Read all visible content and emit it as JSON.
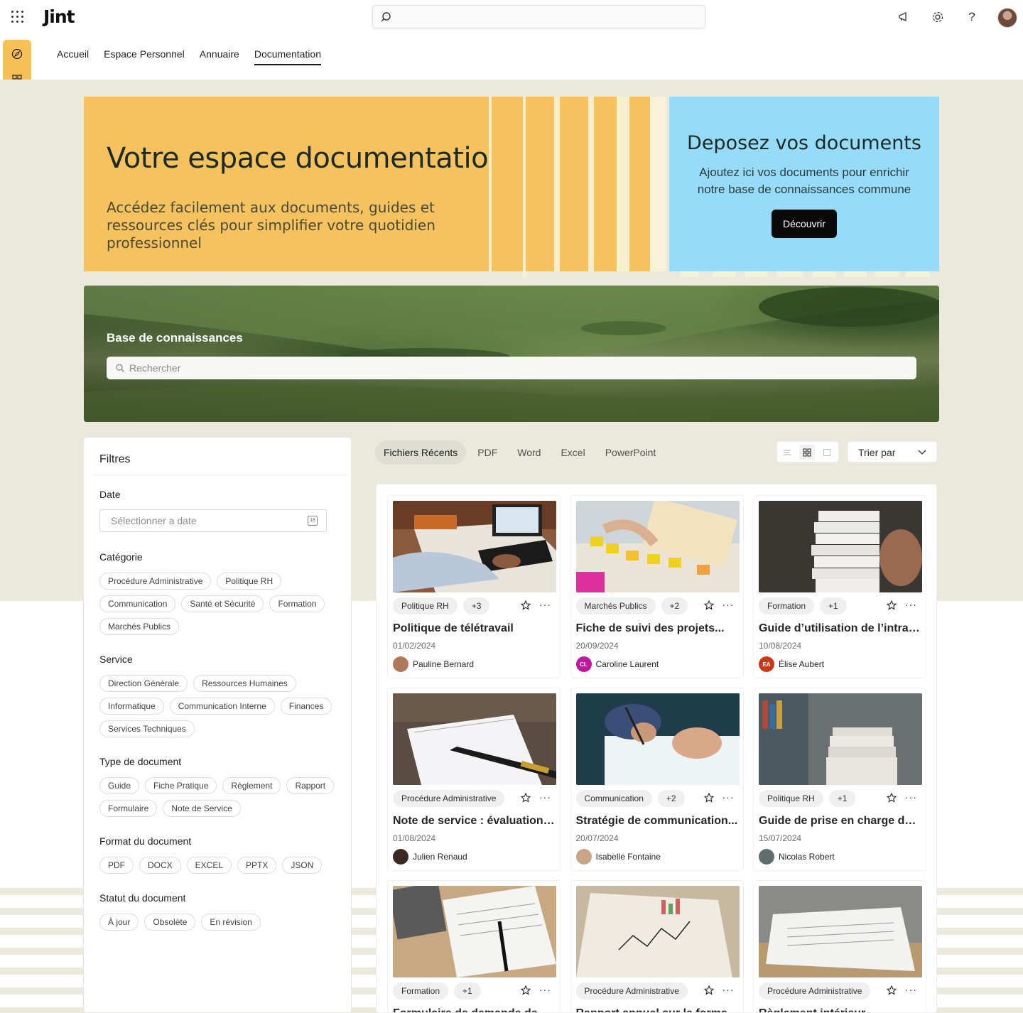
{
  "app": {
    "logo": "Jint"
  },
  "nav": {
    "items": [
      "Accueil",
      "Espace Personnel",
      "Annuaire",
      "Documentation"
    ],
    "active": "Documentation"
  },
  "hero": {
    "title": "Votre espace documentation",
    "subtitle": "Accédez facilement aux documents, guides et ressources clés pour simplifier votre quotidien professionnel"
  },
  "deposit": {
    "title": "Deposez vos documents",
    "text": "Ajoutez ici vos documents pour enrichir notre base de connaissances commune",
    "button": "Découvrir"
  },
  "knowledge": {
    "title": "Base de connaissances",
    "placeholder": "Rechercher"
  },
  "filters": {
    "title": "Filtres",
    "date_label": "Date",
    "date_placeholder": "Sélectionner a date",
    "sections": [
      {
        "title": "Catégorie",
        "chips": [
          "Procédure Administrative",
          "Politique RH",
          "Communication",
          "Santé et Sécurité",
          "Formation",
          "Marchés Publics"
        ]
      },
      {
        "title": "Service",
        "chips": [
          "Direction Générale",
          "Ressources Humaines",
          "Informatique",
          "Communication Interne",
          "Finances",
          "Services Techniques"
        ]
      },
      {
        "title": "Type de document",
        "chips": [
          "Guide",
          "Fiche Pratique",
          "Règlement",
          "Rapport",
          "Formulaire",
          "Note de Service"
        ]
      },
      {
        "title": "Format du document",
        "chips": [
          "PDF",
          "DOCX",
          "EXCEL",
          "PPTX",
          "JSON"
        ]
      },
      {
        "title": "Statut du document",
        "chips": [
          "À jour",
          "Obsolète",
          "En révision"
        ]
      }
    ]
  },
  "tabs": {
    "items": [
      "Fichiers Récents",
      "PDF",
      "Word",
      "Excel",
      "PowerPoint"
    ],
    "active": "Fichiers Récents"
  },
  "sort": {
    "label": "Trier par"
  },
  "cards": [
    {
      "tag": "Politique RH",
      "extra": "+3",
      "title": "Politique de télétravail",
      "date": "01/02/2024",
      "author": "Pauline Bernard",
      "initials": "",
      "avatar_color": "#b07a5a",
      "img": "laptop"
    },
    {
      "tag": "Marchés Publics",
      "extra": "+2",
      "title": "Fiche de suivi des projets...",
      "date": "20/09/2024",
      "author": "Caroline Laurent",
      "initials": "CL",
      "avatar_color": "#c0179e",
      "img": "postits"
    },
    {
      "tag": "Formation",
      "extra": "+1",
      "title": "Guide d’utilisation de l’intran...",
      "date": "10/08/2024",
      "author": "Élise Aubert",
      "initials": "EA",
      "avatar_color": "#c8391a",
      "img": "paperstack"
    },
    {
      "tag": "Procédure Administrative",
      "extra": "",
      "title": "Note de service : évaluations...",
      "date": "01/08/2024",
      "author": "Julien Renaud",
      "initials": "",
      "avatar_color": "#3a2a20",
      "img": "notebook"
    },
    {
      "tag": "Communication",
      "extra": "+2",
      "title": "Stratégie de communication...",
      "date": "20/07/2024",
      "author": "Isabelle Fontaine",
      "initials": "",
      "avatar_color": "#c9a68a",
      "img": "signing"
    },
    {
      "tag": "Politique RH",
      "extra": "+1",
      "title": "Guide de prise en charge des...",
      "date": "15/07/2024",
      "author": "Nicolas Robert",
      "initials": "",
      "avatar_color": "#5e6e6a",
      "img": "library"
    },
    {
      "tag": "Formation",
      "extra": "+1",
      "title": "Formulaire de demande de co...",
      "date": "",
      "author": "",
      "initials": "",
      "avatar_color": "#888888",
      "img": "forms"
    },
    {
      "tag": "Procédure Administrative",
      "extra": "",
      "title": "Rapport annuel sur la formati...",
      "date": "",
      "author": "",
      "initials": "",
      "avatar_color": "#888888",
      "img": "charts"
    },
    {
      "tag": "Procédure Administrative",
      "extra": "",
      "title": "Règlement intérieur",
      "date": "",
      "author": "",
      "initials": "",
      "avatar_color": "#888888",
      "img": "folders"
    }
  ]
}
